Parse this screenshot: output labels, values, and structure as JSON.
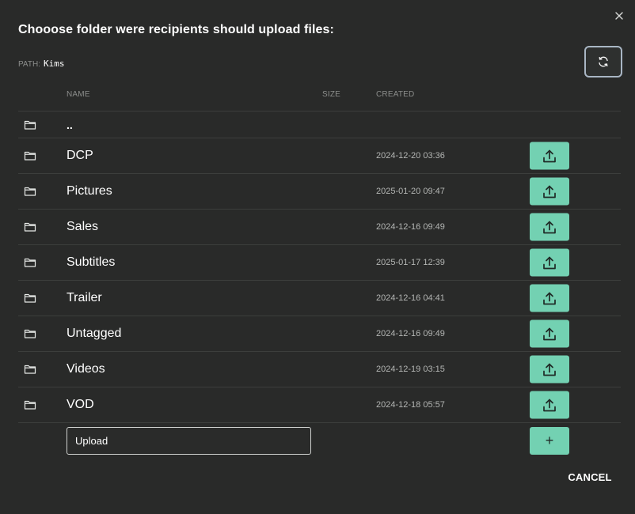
{
  "dialog": {
    "title": "Chooose folder were recipients should upload files:",
    "close_icon": "close-icon"
  },
  "path": {
    "label": "PATH:",
    "value": "Kims"
  },
  "refresh": {
    "icon": "refresh-icon"
  },
  "table": {
    "columns": {
      "name": "NAME",
      "size": "SIZE",
      "created": "CREATED"
    },
    "parent": {
      "name": ".."
    },
    "rows": [
      {
        "name": "DCP",
        "size": "",
        "created": "2024-12-20 03:36"
      },
      {
        "name": "Pictures",
        "size": "",
        "created": "2025-01-20 09:47"
      },
      {
        "name": "Sales",
        "size": "",
        "created": "2024-12-16 09:49"
      },
      {
        "name": "Subtitles",
        "size": "",
        "created": "2025-01-17 12:39"
      },
      {
        "name": "Trailer",
        "size": "",
        "created": "2024-12-16 04:41"
      },
      {
        "name": "Untagged",
        "size": "",
        "created": "2024-12-16 09:49"
      },
      {
        "name": "Videos",
        "size": "",
        "created": "2024-12-19 03:15"
      },
      {
        "name": "VOD",
        "size": "",
        "created": "2024-12-18 05:57"
      }
    ]
  },
  "new_folder": {
    "value": "Upload",
    "add_label": "+"
  },
  "footer": {
    "cancel_label": "CANCEL"
  },
  "colors": {
    "background": "#292a29",
    "accent": "#73d1b2",
    "divider": "#3c3e3c",
    "muted_text": "#8b8d8b"
  }
}
